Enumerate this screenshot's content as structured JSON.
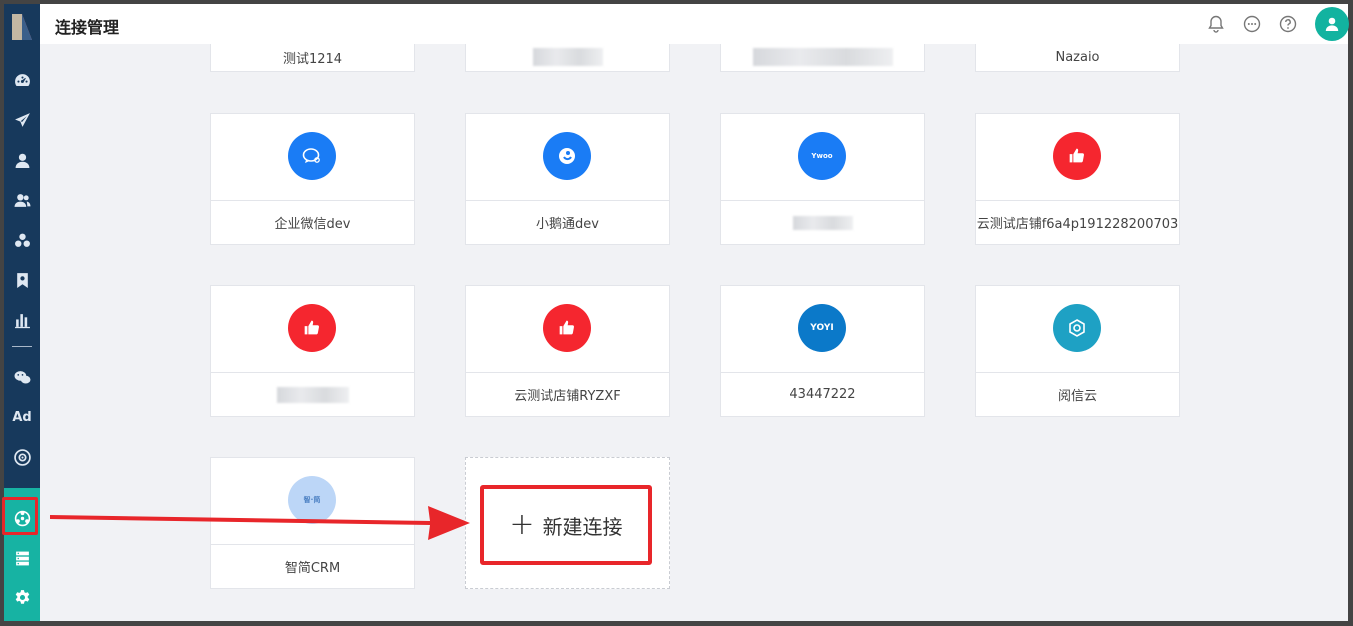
{
  "header": {
    "title": "连接管理",
    "icons": [
      "bell-icon",
      "chat-icon",
      "help-icon",
      "user-avatar-icon"
    ]
  },
  "sidebar": {
    "items": [
      {
        "icon": "dashboard-icon"
      },
      {
        "icon": "send-icon"
      },
      {
        "icon": "user-icon"
      },
      {
        "icon": "users-icon"
      },
      {
        "icon": "segments-icon"
      },
      {
        "icon": "bookmark-icon"
      },
      {
        "icon": "bar-chart-icon"
      },
      {
        "icon": "wechat-icon"
      },
      {
        "label": "Ad"
      },
      {
        "icon": "target-icon"
      },
      {
        "icon": "connection-icon",
        "active": true
      },
      {
        "icon": "server-icon"
      },
      {
        "icon": "gear-icon"
      }
    ]
  },
  "cards": {
    "row0": [
      "测试1214",
      "",
      "",
      "Nazaio"
    ],
    "row1": [
      "企业微信dev",
      "小鹅通dev",
      "",
      "云测试店铺f6a4p191228200703"
    ],
    "row2": [
      "",
      "云测试店铺RYZXF",
      "43447222",
      "阅信云"
    ],
    "row3": [
      "智简CRM"
    ]
  },
  "logos": {
    "ywoo": "Ywoo",
    "yoyi": "YOYI",
    "zhijian": "智·简"
  },
  "new_connection": {
    "label": "新建连接",
    "plus": "+"
  },
  "colors": {
    "sidebar": "#17395c",
    "sidebar_teal": "#17b3a3",
    "highlight_red": "#e8262a",
    "wechat_blue": "#1a7cf5",
    "youzan_red": "#f5262f",
    "yoyi_blue": "#0b79c9",
    "yuexin_teal": "#1ea1c4",
    "zhijian_light": "#bcd6f7"
  }
}
